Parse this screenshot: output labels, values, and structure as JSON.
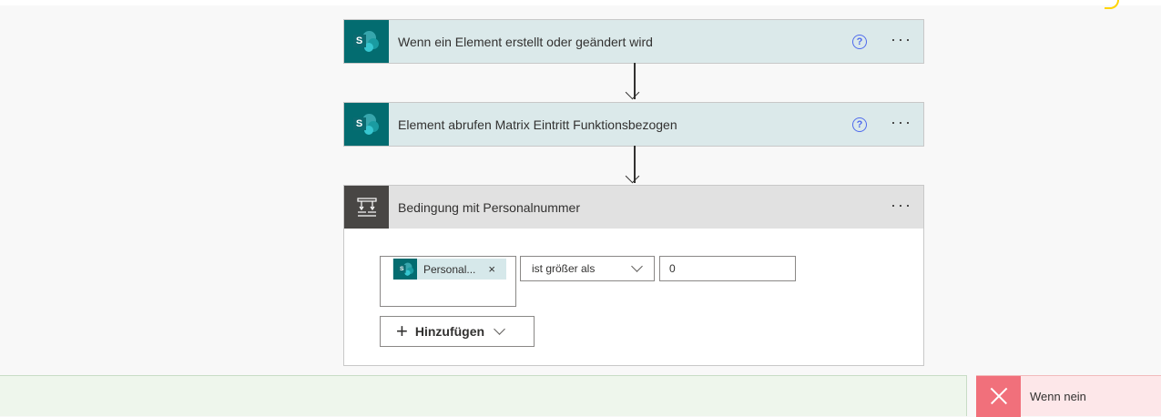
{
  "steps": [
    {
      "title": "Wenn ein Element erstellt oder geändert wird",
      "icon": "sharepoint-icon",
      "help": "?",
      "more": "···"
    },
    {
      "title": "Element abrufen Matrix Eintritt Funktionsbezogen",
      "icon": "sharepoint-icon",
      "help": "?",
      "more": "···"
    }
  ],
  "sp_letter": "S",
  "condition": {
    "title": "Bedingung mit Personalnummer",
    "icon": "condition-icon",
    "more": "···",
    "token_label": "Personal...",
    "token_remove": "×",
    "operator": "ist größer als",
    "value": "0",
    "add_label": "Hinzufügen",
    "add_plus": "+"
  },
  "branches": {
    "no_label": "Wenn nein"
  },
  "colors": {
    "sharepoint_teal": "#036c70",
    "step_header_bg": "#dbe9ea",
    "condition_header_bg": "#e1e1e1",
    "yes_band_bg": "#eef6ec",
    "no_band_bg": "#fde7e9",
    "no_icon_bg": "#f1707b",
    "help_blue": "#4f6bed"
  }
}
